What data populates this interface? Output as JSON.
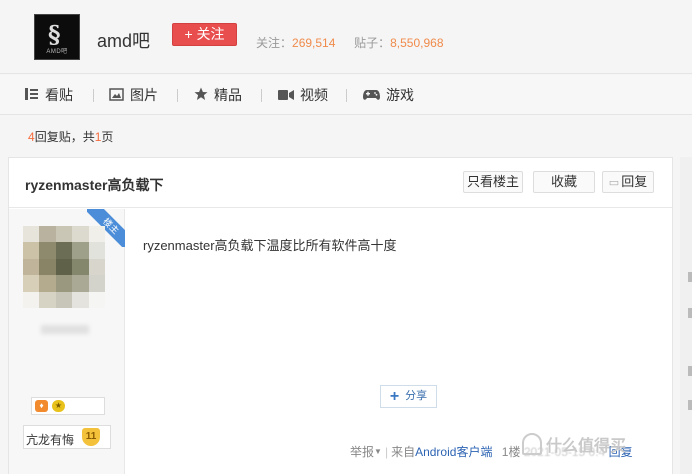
{
  "forum": {
    "name": "amd吧",
    "logo_text": "AMD吧",
    "follow_label": "+ 关注",
    "stats": {
      "follow_label": "关注：",
      "follow_count": "269,514",
      "posts_label": "贴子：",
      "posts_count": "8,550,968"
    }
  },
  "nav": {
    "items": [
      {
        "label": "看贴",
        "icon": "posts-icon"
      },
      {
        "label": "图片",
        "icon": "image-icon"
      },
      {
        "label": "精品",
        "icon": "star-icon"
      },
      {
        "label": "视频",
        "icon": "video-icon"
      },
      {
        "label": "游戏",
        "icon": "gamepad-icon"
      }
    ]
  },
  "reply_bar": {
    "count": "4",
    "text1": "回复贴，共",
    "pages": "1",
    "text2": "页"
  },
  "thread": {
    "title": "ryzenmaster高负载下",
    "buttons": {
      "only_op": "只看楼主",
      "favorite": "收藏",
      "reply": "回复"
    },
    "post": {
      "op_tag": "楼主",
      "content": "ryzenmaster高负载下温度比所有软件高十度",
      "user": {
        "level_name": "亢龙有悔",
        "level": "11"
      },
      "share_label": "分享",
      "meta": {
        "report": "举报",
        "from_prefix": "来自",
        "client": "Android客户端",
        "floor": "1楼",
        "date_obscured": "2021-05-15 0:4",
        "reply_link": "回复"
      }
    }
  },
  "watermark": "什么值得买",
  "colors": {
    "accent_red": "#e94e4e",
    "stat_orange": "#f08b4b",
    "link_blue": "#2d64b3",
    "op_tag_blue": "#4b8dd8"
  }
}
